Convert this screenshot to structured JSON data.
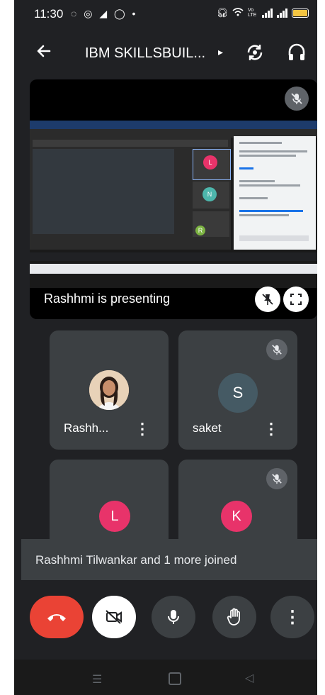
{
  "status_bar": {
    "time": "11:30",
    "left_icons": "◌ ◎ ◢ ◯ •",
    "network": "Vo LTE"
  },
  "header": {
    "title": "IBM SKILLSBUIL...",
    "caret": "▸"
  },
  "presentation": {
    "label": "Rashhmi is presenting",
    "mini_tiles": [
      "L",
      "N",
      "R"
    ]
  },
  "participants": [
    {
      "name": "Rashh...",
      "initial": "",
      "avatar_color": "#e8c9a8",
      "muted": false
    },
    {
      "name": "saket",
      "initial": "S",
      "avatar_color": "#455a64",
      "muted": true
    },
    {
      "name": "",
      "initial": "L",
      "avatar_color": "#e8336a",
      "muted": false
    },
    {
      "name": "",
      "initial": "K",
      "avatar_color": "#e8336a",
      "muted": true
    }
  ],
  "toast": {
    "text": "Rashhmi Tilwankar and 1 more joined"
  },
  "controls": {
    "more": "⋮"
  },
  "colors": {
    "background": "#202124",
    "tile": "#3c4043",
    "end_call": "#ea4335",
    "avatar_pink": "#e8336a",
    "avatar_slate": "#455a64"
  }
}
